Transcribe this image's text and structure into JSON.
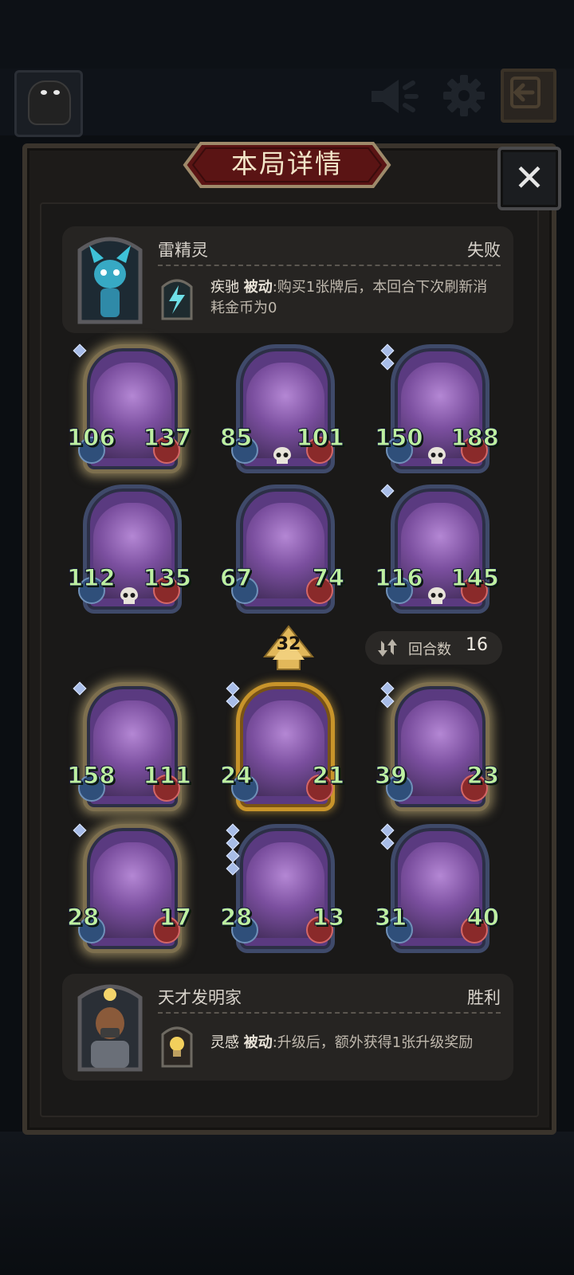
{
  "title": "本局详情",
  "close_glyph": "✕",
  "top_bar": {
    "speaker_icon": "speaker-icon",
    "gear_icon": "gear-icon",
    "exit_icon": "exit-arrow-icon"
  },
  "opponent": {
    "name": "雷精灵",
    "result": "失败",
    "skill": {
      "name": "疾驰",
      "tag": "被动",
      "desc": ":购买1张牌后，本回合下次刷新消耗金币为0"
    }
  },
  "player": {
    "name": "天才发明家",
    "result": "胜利",
    "skill": {
      "name": "灵感",
      "tag": "被动",
      "desc": ":升级后，额外获得1张升级奖励"
    }
  },
  "opponent_units": [
    {
      "atk": "106",
      "hp": "137",
      "glow": true,
      "skull": false,
      "gems": 1
    },
    {
      "atk": "85",
      "hp": "101",
      "glow": false,
      "skull": true,
      "gems": 0
    },
    {
      "atk": "150",
      "hp": "188",
      "glow": false,
      "skull": true,
      "gems": 2
    },
    {
      "atk": "112",
      "hp": "135",
      "glow": false,
      "skull": true,
      "gems": 0
    },
    {
      "atk": "67",
      "hp": "74",
      "glow": false,
      "skull": false,
      "gems": 0
    },
    {
      "atk": "116",
      "hp": "145",
      "glow": false,
      "skull": true,
      "gems": 1
    }
  ],
  "player_units": [
    {
      "atk": "158",
      "hp": "111",
      "glow": true,
      "skull": false,
      "gems": 1
    },
    {
      "atk": "24",
      "hp": "21",
      "gold": true,
      "skull": false,
      "gems": 2
    },
    {
      "atk": "39",
      "hp": "23",
      "glow": true,
      "skull": false,
      "gems": 2
    },
    {
      "atk": "28",
      "hp": "17",
      "glow": true,
      "skull": false,
      "gems": 1
    },
    {
      "atk": "28",
      "hp": "13",
      "glow": false,
      "skull": false,
      "gems": 4
    },
    {
      "atk": "31",
      "hp": "40",
      "glow": false,
      "skull": false,
      "gems": 2
    }
  ],
  "level": "32",
  "rounds": {
    "label": "回合数",
    "value": "16"
  }
}
